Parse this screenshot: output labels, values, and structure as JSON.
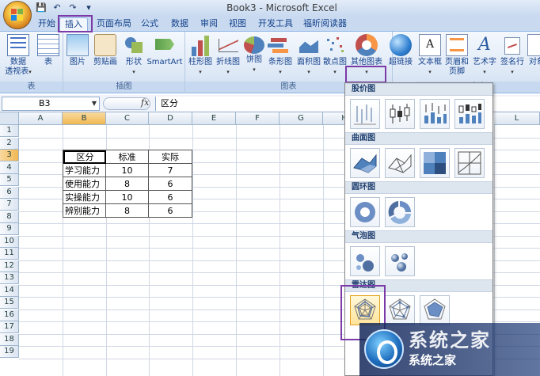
{
  "window": {
    "title": "Book3 - Microsoft Excel"
  },
  "qat": [
    "save-icon",
    "undo-icon",
    "redo-icon",
    "customize-icon"
  ],
  "tabs": [
    "开始",
    "插入",
    "页面布局",
    "公式",
    "数据",
    "审阅",
    "视图",
    "开发工具",
    "福昕阅读器"
  ],
  "active_tab": "插入",
  "ribbon": {
    "groups": {
      "table": "表",
      "illustrations": "插图",
      "charts": "图表",
      "text": "文本"
    },
    "pivot": {
      "line1": "数据",
      "line2": "透视表"
    },
    "table": "表",
    "picture": "图片",
    "clipart": "剪贴画",
    "shapes": "形状",
    "smartart": "SmartArt",
    "column": "柱形图",
    "line": "折线图",
    "pie": "饼图",
    "bar": "条形图",
    "area": "面积图",
    "scatter": "散点图",
    "other": "其他图表",
    "hyperlink": "超链接",
    "textbox": "文本框",
    "header_footer": {
      "line1": "页眉和",
      "line2": "页脚"
    },
    "wordart": "艺术字",
    "signature": "签名行",
    "object": "对象"
  },
  "formula_bar": {
    "name_box": "B3",
    "fx": "fx",
    "content": "区分"
  },
  "columns": [
    "A",
    "B",
    "C",
    "D",
    "E",
    "F",
    "G",
    "H",
    "L"
  ],
  "rows": [
    "1",
    "2",
    "3",
    "4",
    "5",
    "6",
    "7",
    "8",
    "9",
    "10",
    "11",
    "12",
    "13",
    "14",
    "15",
    "16",
    "17",
    "18",
    "19"
  ],
  "data_table": {
    "header": [
      "区分",
      "标准",
      "实际"
    ],
    "rows": [
      [
        "学习能力",
        "10",
        "7"
      ],
      [
        "使用能力",
        "8",
        "6"
      ],
      [
        "实操能力",
        "10",
        "6"
      ],
      [
        "辨别能力",
        "8",
        "6"
      ]
    ]
  },
  "gallery": {
    "sections": [
      "股价图",
      "曲面图",
      "圆环图",
      "气泡图",
      "雷达图"
    ]
  },
  "watermark": {
    "big": "系统之家",
    "small": "系统之家"
  }
}
